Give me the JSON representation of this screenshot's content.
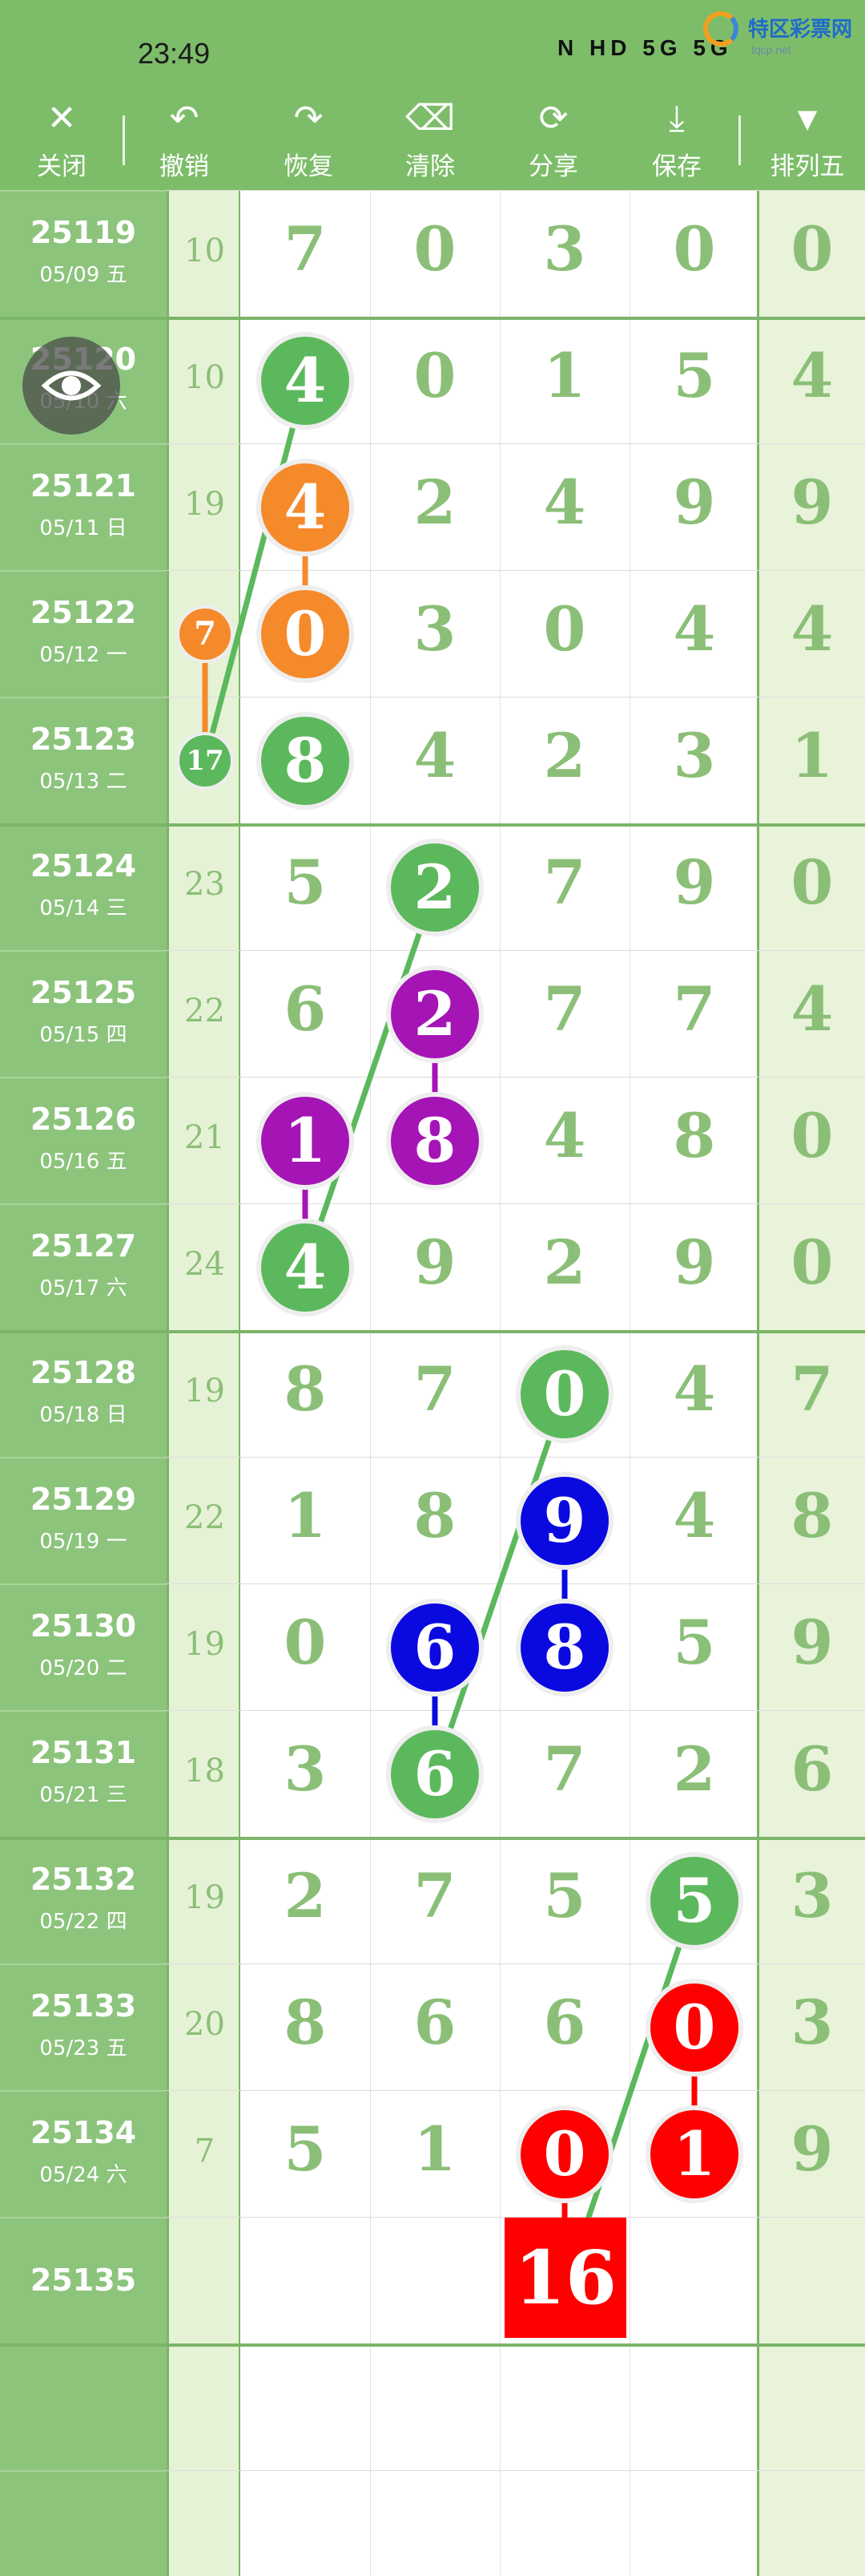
{
  "status_bar": {
    "time": "23:49",
    "icons_text": "N HD 5G 5G",
    "logo_name": "特区彩票网",
    "logo_url": "tqcp.net"
  },
  "toolbar": {
    "buttons": [
      {
        "label": "关闭",
        "icon": "close-icon"
      },
      {
        "label": "撤销",
        "icon": "undo-icon"
      },
      {
        "label": "恢复",
        "icon": "redo-icon"
      },
      {
        "label": "清除",
        "icon": "clear-icon"
      },
      {
        "label": "分享",
        "icon": "share-icon"
      },
      {
        "label": "保存",
        "icon": "save-icon"
      },
      {
        "label": "排列五",
        "icon": "dropdown-triangle-icon"
      }
    ]
  },
  "colors": {
    "green": "#5cb85c",
    "orange": "#f58a2b",
    "purple": "#a514b5",
    "blue": "#0a0ae0",
    "red": "#ff0000"
  },
  "rows": [
    {
      "period": "25119",
      "date": "05/09 五",
      "sum": "10",
      "digits": [
        "7",
        "0",
        "3",
        "0"
      ],
      "last": "0"
    },
    {
      "period": "25120",
      "date": "05/10 六",
      "sum": "10",
      "digits": [
        "4",
        "0",
        "1",
        "5"
      ],
      "last": "4"
    },
    {
      "period": "25121",
      "date": "05/11 日",
      "sum": "19",
      "digits": [
        "4",
        "2",
        "4",
        "9"
      ],
      "last": "9"
    },
    {
      "period": "25122",
      "date": "05/12 一",
      "sum": "",
      "digits": [
        "0",
        "3",
        "0",
        "4"
      ],
      "last": "4"
    },
    {
      "period": "25123",
      "date": "05/13 二",
      "sum": "",
      "digits": [
        "8",
        "4",
        "2",
        "3"
      ],
      "last": "1"
    },
    {
      "period": "25124",
      "date": "05/14 三",
      "sum": "23",
      "digits": [
        "5",
        "2",
        "7",
        "9"
      ],
      "last": "0"
    },
    {
      "period": "25125",
      "date": "05/15 四",
      "sum": "22",
      "digits": [
        "6",
        "2",
        "7",
        "7"
      ],
      "last": "4"
    },
    {
      "period": "25126",
      "date": "05/16 五",
      "sum": "21",
      "digits": [
        "1",
        "8",
        "4",
        "8"
      ],
      "last": "0"
    },
    {
      "period": "25127",
      "date": "05/17 六",
      "sum": "24",
      "digits": [
        "4",
        "9",
        "2",
        "9"
      ],
      "last": "0"
    },
    {
      "period": "25128",
      "date": "05/18 日",
      "sum": "19",
      "digits": [
        "8",
        "7",
        "0",
        "4"
      ],
      "last": "7"
    },
    {
      "period": "25129",
      "date": "05/19 一",
      "sum": "22",
      "digits": [
        "1",
        "8",
        "9",
        "4"
      ],
      "last": "8"
    },
    {
      "period": "25130",
      "date": "05/20 二",
      "sum": "19",
      "digits": [
        "0",
        "6",
        "8",
        "5"
      ],
      "last": "9"
    },
    {
      "period": "25131",
      "date": "05/21 三",
      "sum": "18",
      "digits": [
        "3",
        "6",
        "7",
        "2"
      ],
      "last": "6"
    },
    {
      "period": "25132",
      "date": "05/22 四",
      "sum": "19",
      "digits": [
        "2",
        "7",
        "5",
        "5"
      ],
      "last": "3"
    },
    {
      "period": "25133",
      "date": "05/23 五",
      "sum": "20",
      "digits": [
        "8",
        "6",
        "6",
        "0"
      ],
      "last": "3"
    },
    {
      "period": "25134",
      "date": "05/24 六",
      "sum": "7",
      "digits": [
        "5",
        "1",
        "0",
        "1"
      ],
      "last": "9"
    },
    {
      "period": "25135",
      "date": "",
      "sum": "",
      "digits": [
        "",
        "",
        "",
        ""
      ],
      "last": ""
    }
  ],
  "marks": {
    "side_balls": [
      "7",
      "17"
    ],
    "result": "16"
  }
}
